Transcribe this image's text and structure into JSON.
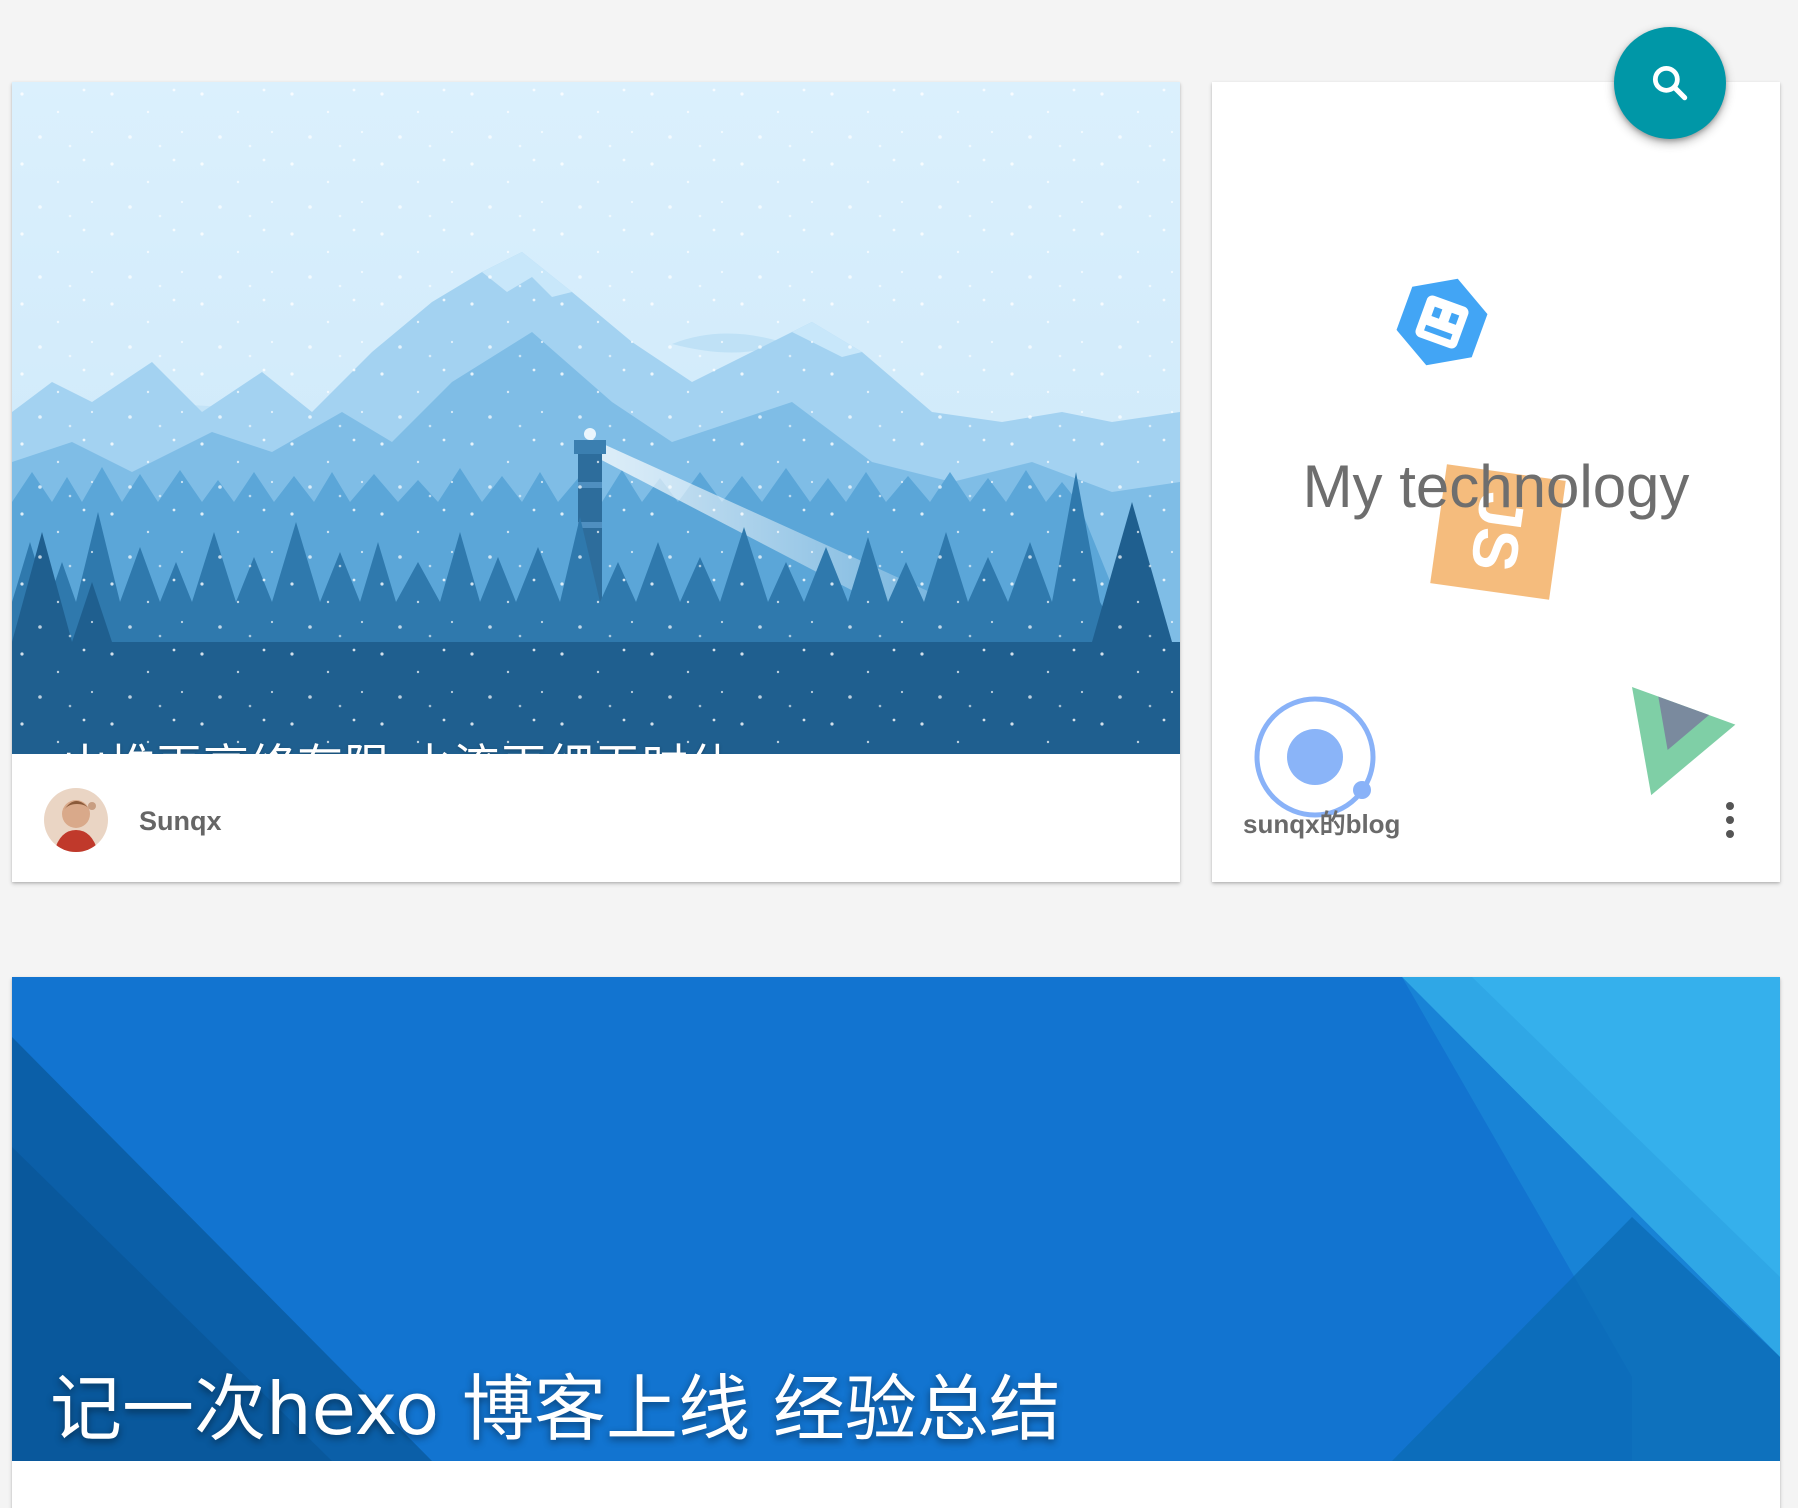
{
  "hero_card": {
    "title": "山堆再高终有限,水流再细无时休",
    "author": "Sunqx"
  },
  "tech_card": {
    "title": "My technology",
    "blog_name": "sunqx的blog"
  },
  "post_card": {
    "title": "记一次hexo 博客上线 经验总结"
  },
  "fab": {
    "icon": "search-icon"
  },
  "colors": {
    "page_bg": "#f4f4f4",
    "fab": "#0097a7",
    "sky": "#d9effc",
    "post_blue": "#1274d0"
  }
}
